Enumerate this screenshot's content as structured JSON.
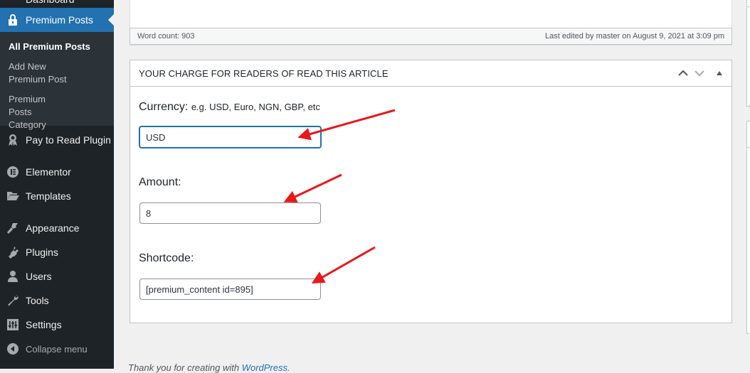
{
  "admin_menu": {
    "cut_item_label": "Dashboard",
    "current": {
      "label": "Premium Posts",
      "icon": "lock-icon"
    },
    "submenu": [
      {
        "label": "All Premium Posts",
        "current": true
      },
      {
        "label": "Add New Premium Post",
        "current": false
      },
      {
        "label": "Premium Posts Category",
        "current": false
      }
    ],
    "items": [
      {
        "label": "Pay to Read Plugin",
        "icon": "award-ribbon-icon"
      },
      {
        "label": "Elementor",
        "icon": "elementor-icon"
      },
      {
        "label": "Templates",
        "icon": "folder-icon"
      },
      {
        "label": "Appearance",
        "icon": "paintbrush-icon"
      },
      {
        "label": "Plugins",
        "icon": "plug-icon"
      },
      {
        "label": "Users",
        "icon": "user-icon"
      },
      {
        "label": "Tools",
        "icon": "wrench-icon"
      },
      {
        "label": "Settings",
        "icon": "sliders-icon"
      }
    ],
    "collapse_label": "Collapse menu"
  },
  "editor_status": {
    "word_count": "Word count: 903",
    "last_edited": "Last edited by master on August 9, 2021 at 3:09 pm"
  },
  "metabox": {
    "title": "YOUR CHARGE FOR READERS OF READ THIS ARTICLE",
    "controls": [
      "move-up",
      "move-down",
      "toggle-panel"
    ],
    "fields": {
      "currency": {
        "label": "Currency:",
        "hint": "e.g. USD, Euro, NGN, GBP, etc",
        "value": "USD"
      },
      "amount": {
        "label": "Amount:",
        "value": "8"
      },
      "shortcode": {
        "label": "Shortcode:",
        "value": "[premium_content id=895]"
      }
    }
  },
  "footer": {
    "text": "Thank you for creating with ",
    "link": "WordPress."
  },
  "annotation": {
    "arrow_color": "#e8191b",
    "arrow_count": 3
  }
}
